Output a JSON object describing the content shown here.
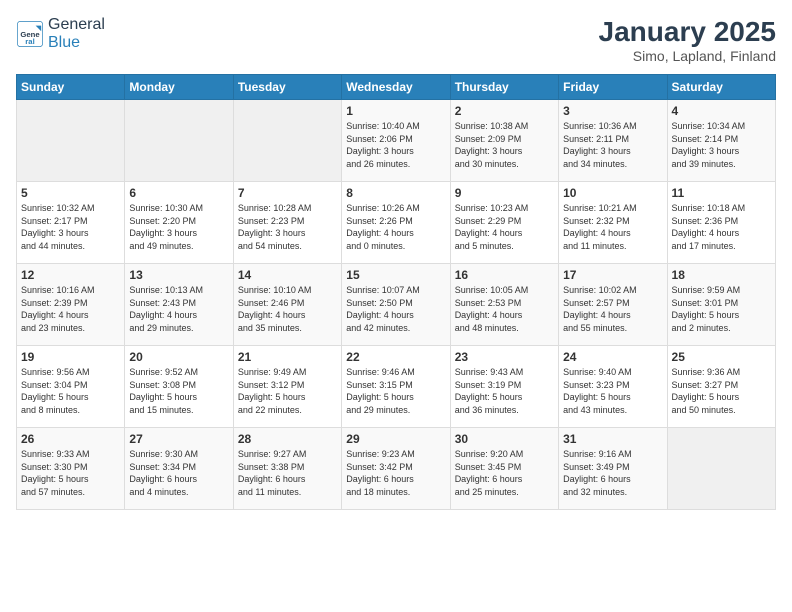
{
  "header": {
    "logo_general": "General",
    "logo_blue": "Blue",
    "title": "January 2025",
    "subtitle": "Simo, Lapland, Finland"
  },
  "weekdays": [
    "Sunday",
    "Monday",
    "Tuesday",
    "Wednesday",
    "Thursday",
    "Friday",
    "Saturday"
  ],
  "weeks": [
    [
      {
        "day": "",
        "info": ""
      },
      {
        "day": "",
        "info": ""
      },
      {
        "day": "",
        "info": ""
      },
      {
        "day": "1",
        "info": "Sunrise: 10:40 AM\nSunset: 2:06 PM\nDaylight: 3 hours\nand 26 minutes."
      },
      {
        "day": "2",
        "info": "Sunrise: 10:38 AM\nSunset: 2:09 PM\nDaylight: 3 hours\nand 30 minutes."
      },
      {
        "day": "3",
        "info": "Sunrise: 10:36 AM\nSunset: 2:11 PM\nDaylight: 3 hours\nand 34 minutes."
      },
      {
        "day": "4",
        "info": "Sunrise: 10:34 AM\nSunset: 2:14 PM\nDaylight: 3 hours\nand 39 minutes."
      }
    ],
    [
      {
        "day": "5",
        "info": "Sunrise: 10:32 AM\nSunset: 2:17 PM\nDaylight: 3 hours\nand 44 minutes."
      },
      {
        "day": "6",
        "info": "Sunrise: 10:30 AM\nSunset: 2:20 PM\nDaylight: 3 hours\nand 49 minutes."
      },
      {
        "day": "7",
        "info": "Sunrise: 10:28 AM\nSunset: 2:23 PM\nDaylight: 3 hours\nand 54 minutes."
      },
      {
        "day": "8",
        "info": "Sunrise: 10:26 AM\nSunset: 2:26 PM\nDaylight: 4 hours\nand 0 minutes."
      },
      {
        "day": "9",
        "info": "Sunrise: 10:23 AM\nSunset: 2:29 PM\nDaylight: 4 hours\nand 5 minutes."
      },
      {
        "day": "10",
        "info": "Sunrise: 10:21 AM\nSunset: 2:32 PM\nDaylight: 4 hours\nand 11 minutes."
      },
      {
        "day": "11",
        "info": "Sunrise: 10:18 AM\nSunset: 2:36 PM\nDaylight: 4 hours\nand 17 minutes."
      }
    ],
    [
      {
        "day": "12",
        "info": "Sunrise: 10:16 AM\nSunset: 2:39 PM\nDaylight: 4 hours\nand 23 minutes."
      },
      {
        "day": "13",
        "info": "Sunrise: 10:13 AM\nSunset: 2:43 PM\nDaylight: 4 hours\nand 29 minutes."
      },
      {
        "day": "14",
        "info": "Sunrise: 10:10 AM\nSunset: 2:46 PM\nDaylight: 4 hours\nand 35 minutes."
      },
      {
        "day": "15",
        "info": "Sunrise: 10:07 AM\nSunset: 2:50 PM\nDaylight: 4 hours\nand 42 minutes."
      },
      {
        "day": "16",
        "info": "Sunrise: 10:05 AM\nSunset: 2:53 PM\nDaylight: 4 hours\nand 48 minutes."
      },
      {
        "day": "17",
        "info": "Sunrise: 10:02 AM\nSunset: 2:57 PM\nDaylight: 4 hours\nand 55 minutes."
      },
      {
        "day": "18",
        "info": "Sunrise: 9:59 AM\nSunset: 3:01 PM\nDaylight: 5 hours\nand 2 minutes."
      }
    ],
    [
      {
        "day": "19",
        "info": "Sunrise: 9:56 AM\nSunset: 3:04 PM\nDaylight: 5 hours\nand 8 minutes."
      },
      {
        "day": "20",
        "info": "Sunrise: 9:52 AM\nSunset: 3:08 PM\nDaylight: 5 hours\nand 15 minutes."
      },
      {
        "day": "21",
        "info": "Sunrise: 9:49 AM\nSunset: 3:12 PM\nDaylight: 5 hours\nand 22 minutes."
      },
      {
        "day": "22",
        "info": "Sunrise: 9:46 AM\nSunset: 3:15 PM\nDaylight: 5 hours\nand 29 minutes."
      },
      {
        "day": "23",
        "info": "Sunrise: 9:43 AM\nSunset: 3:19 PM\nDaylight: 5 hours\nand 36 minutes."
      },
      {
        "day": "24",
        "info": "Sunrise: 9:40 AM\nSunset: 3:23 PM\nDaylight: 5 hours\nand 43 minutes."
      },
      {
        "day": "25",
        "info": "Sunrise: 9:36 AM\nSunset: 3:27 PM\nDaylight: 5 hours\nand 50 minutes."
      }
    ],
    [
      {
        "day": "26",
        "info": "Sunrise: 9:33 AM\nSunset: 3:30 PM\nDaylight: 5 hours\nand 57 minutes."
      },
      {
        "day": "27",
        "info": "Sunrise: 9:30 AM\nSunset: 3:34 PM\nDaylight: 6 hours\nand 4 minutes."
      },
      {
        "day": "28",
        "info": "Sunrise: 9:27 AM\nSunset: 3:38 PM\nDaylight: 6 hours\nand 11 minutes."
      },
      {
        "day": "29",
        "info": "Sunrise: 9:23 AM\nSunset: 3:42 PM\nDaylight: 6 hours\nand 18 minutes."
      },
      {
        "day": "30",
        "info": "Sunrise: 9:20 AM\nSunset: 3:45 PM\nDaylight: 6 hours\nand 25 minutes."
      },
      {
        "day": "31",
        "info": "Sunrise: 9:16 AM\nSunset: 3:49 PM\nDaylight: 6 hours\nand 32 minutes."
      },
      {
        "day": "",
        "info": ""
      }
    ]
  ]
}
